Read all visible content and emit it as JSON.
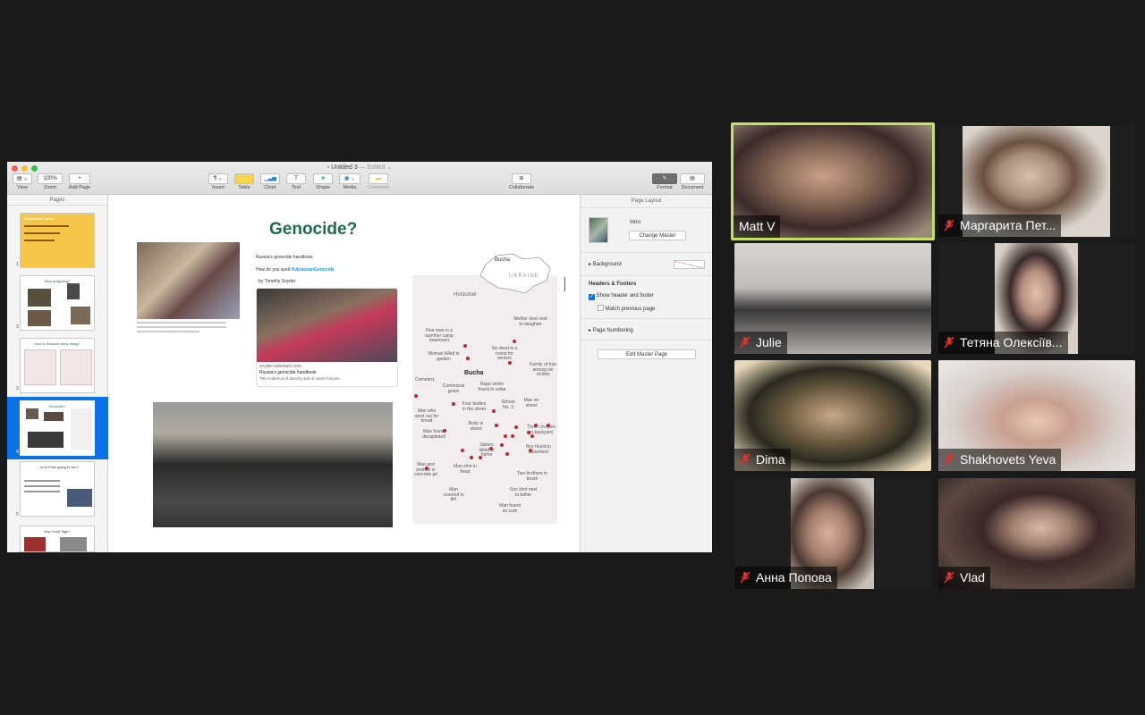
{
  "window": {
    "title": "Untitled 3",
    "edited_status": "— Edited ⌄"
  },
  "toolbar": {
    "view": "View",
    "zoom": "Zoom",
    "zoom_value": "100%",
    "add_page": "Add Page",
    "insert": "Insert",
    "table": "Table",
    "chart": "Chart",
    "text": "Text",
    "shape": "Shape",
    "media": "Media",
    "comment": "Comment",
    "collaborate": "Collaborate",
    "format": "Format",
    "document": "Document"
  },
  "sidebar": {
    "header": "Pages",
    "pages": [
      {
        "num": "1",
        "title": "What we've done"
      },
      {
        "num": "3",
        "title": "Who is fighting?"
      },
      {
        "num": "3",
        "title": "How is Russia's army doing?"
      },
      {
        "num": "4",
        "title": "Genocide?"
      },
      {
        "num": "5",
        "title": "... so is Putin going to win?"
      },
      {
        "num": "6",
        "title": "Any Good Sign?"
      }
    ]
  },
  "slide": {
    "title": "Genocide?",
    "article_heading": "Russia's genocide handbook",
    "article_prompt": "How do you spell ",
    "hashtag": "#UkrainianGenocide",
    "author": "- by Timothy Snyder",
    "link_domain": "snyder.substack.com",
    "link_title": "Russia's genocide handbook",
    "link_desc": "The evidence of atrocity and of intent mounts"
  },
  "map": {
    "bucha_top": "Bucha",
    "ukraine": "UKRAINE",
    "hostomel": "Hostomel",
    "bucha": "Bucha",
    "labels": [
      "Mother shot next to daughter",
      "Five men in a summer camp basement",
      "Six dead in a home for seniors",
      "Woman killed in garden",
      "Family of four among six victims",
      "Cemetery",
      "Communal grave",
      "Rape victim found in cellar",
      "Man on street",
      "Man who went out for bread",
      "Four bodies in the street",
      "School No. 3",
      "Three civilians in backyard",
      "Man found decapitated",
      "Body in street",
      "Boy found in basement",
      "Sisters killed in home",
      "Man and woman in concrete pit",
      "Man shot in head",
      "Two brothers in brush",
      "Man covered in dirt",
      "Son shot next to father",
      "Man found on curb"
    ]
  },
  "inspector": {
    "header": "Page Layout",
    "master_name": "Intro",
    "change_master": "Change Master",
    "background": "Background",
    "headers_footers": "Headers & Footers",
    "show_header_footer": "Show header and footer",
    "match_previous": "Match previous page",
    "page_numbering": "Page Numbering",
    "edit_master": "Edit Master Page"
  },
  "participants": [
    {
      "name": "Matt V",
      "muted": false,
      "active": true
    },
    {
      "name": "Маргарита Пет...",
      "muted": true
    },
    {
      "name": "Julie",
      "muted": true
    },
    {
      "name": "Тетяна Олексіїв...",
      "muted": true
    },
    {
      "name": "Dima",
      "muted": true
    },
    {
      "name": "Shakhovets Yeva",
      "muted": true
    },
    {
      "name": "Анна Попова",
      "muted": true
    },
    {
      "name": "Vlad",
      "muted": true
    }
  ],
  "colors": {
    "accent": "#1f6b4a",
    "active_speaker": "#c4e35a",
    "selection": "#0a73e8",
    "muted_mic": "#e0322c",
    "hashtag": "#1a9ad6"
  }
}
